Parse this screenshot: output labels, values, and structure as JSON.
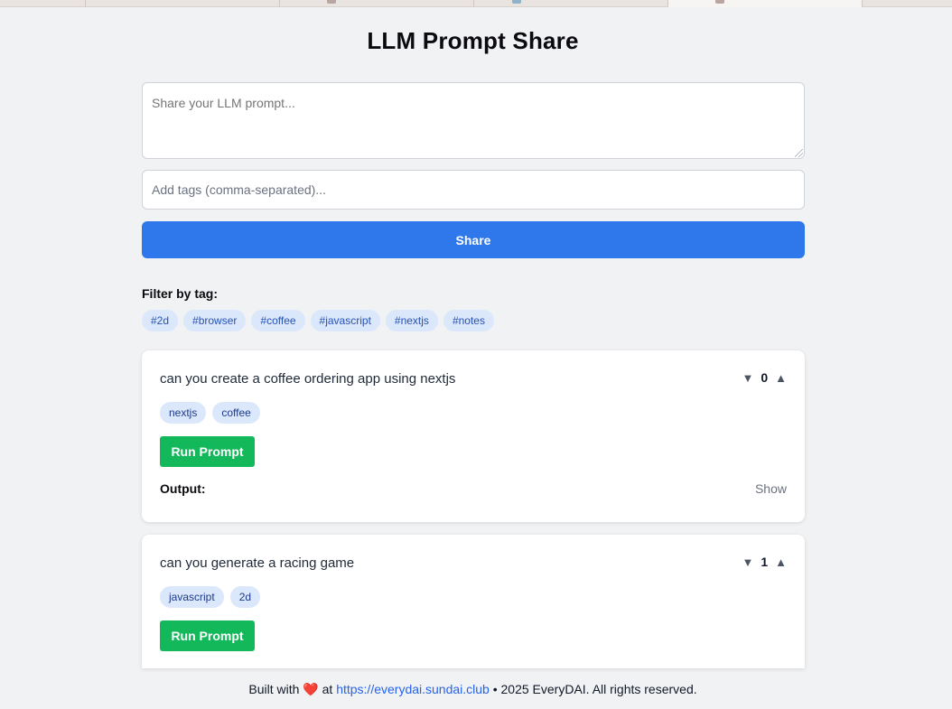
{
  "header": {
    "title": "LLM Prompt Share"
  },
  "composer": {
    "prompt_placeholder": "Share your LLM prompt...",
    "tags_placeholder": "Add tags (comma-separated)...",
    "share_label": "Share"
  },
  "filter": {
    "label": "Filter by tag:",
    "tags": [
      "#2d",
      "#browser",
      "#coffee",
      "#javascript",
      "#nextjs",
      "#notes"
    ]
  },
  "prompts": [
    {
      "text": "can you create a coffee ordering app using nextjs",
      "votes": "0",
      "tags": [
        "nextjs",
        "coffee"
      ],
      "run_label": "Run Prompt",
      "output_label": "Output:",
      "show_label": "Show"
    },
    {
      "text": "can you generate a racing game",
      "votes": "1",
      "tags": [
        "javascript",
        "2d"
      ],
      "run_label": "Run Prompt"
    }
  ],
  "vote_icons": {
    "down": "▼",
    "up": "▲"
  },
  "footer": {
    "prefix": "Built with",
    "heart": "❤️",
    "at": "at",
    "link": "https://everydai.sundai.club",
    "suffix": "• 2025 EveryDAI. All rights reserved."
  }
}
